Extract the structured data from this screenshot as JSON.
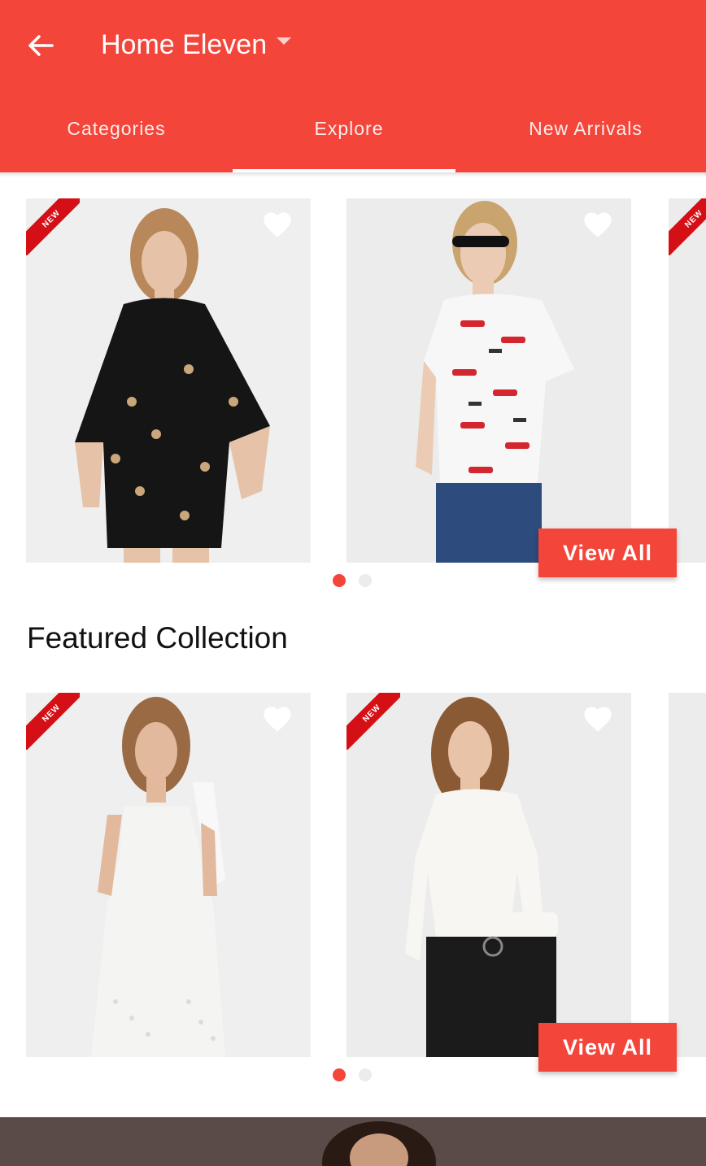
{
  "app_bar": {
    "title": "Home Eleven",
    "back_icon": "arrow-left-icon",
    "dropdown_icon": "caret-down-icon",
    "color": "#f4453a"
  },
  "tabs": [
    {
      "label": "Categories",
      "active": false
    },
    {
      "label": "Explore",
      "active": true
    },
    {
      "label": "New Arrivals",
      "active": false
    }
  ],
  "carousel_1": {
    "cards": [
      {
        "badge": "NEW",
        "product": "black-print-dress-photo",
        "favorite_icon": "heart-icon"
      },
      {
        "badge": "",
        "product": "lipstick-print-tshirt-photo",
        "favorite_icon": "heart-icon"
      },
      {
        "badge": "NEW",
        "product": "partial-card-photo"
      }
    ],
    "button_label": "View All",
    "active_page": 1,
    "pages": 2
  },
  "featured": {
    "title": "Featured Collection",
    "cards": [
      {
        "badge": "NEW",
        "product": "white-jumpsuit-photo",
        "favorite_icon": "heart-icon"
      },
      {
        "badge": "NEW",
        "product": "white-top-leather-pants-photo",
        "favorite_icon": "heart-icon"
      },
      {
        "badge": "",
        "product": "partial-card-photo"
      }
    ],
    "button_label": "View All",
    "active_page": 1,
    "pages": 2
  },
  "banner": {
    "image": "model-banner-photo"
  }
}
